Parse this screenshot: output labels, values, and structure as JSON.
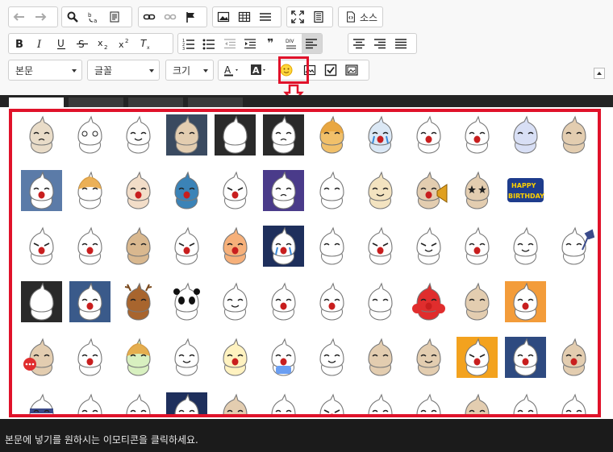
{
  "toolbar": {
    "source_label": "소스",
    "format_combo": "본문",
    "font_combo": "글꼴",
    "size_combo": "크기",
    "quote_label": "❞",
    "div_label": "DIV"
  },
  "emoticons": {
    "items": [
      {
        "skin": "#e9dcc8",
        "bg": "#ffffff",
        "mood": "sad"
      },
      {
        "skin": "#ffffff",
        "bg": "#ffffff",
        "mood": "dizzy"
      },
      {
        "skin": "#ffffff",
        "bg": "#ffffff",
        "mood": "smile"
      },
      {
        "skin": "#e3cdb0",
        "bg": "#3a4a60",
        "mood": "sit"
      },
      {
        "skin": "#ffffff",
        "bg": "#2a2a2a",
        "mood": "back"
      },
      {
        "skin": "#ffffff",
        "bg": "#2a2a2a",
        "mood": "gloom"
      },
      {
        "skin": "#f1c06a",
        "bg": "#ffffff",
        "mood": "hat"
      },
      {
        "skin": "#dbe8f5",
        "bg": "#ffffff",
        "mood": "cry"
      },
      {
        "skin": "#ffffff",
        "bg": "#ffffff",
        "mood": "shout"
      },
      {
        "skin": "#ffffff",
        "bg": "#ffffff",
        "mood": "shout"
      },
      {
        "skin": "#d8dff5",
        "bg": "#ffffff",
        "mood": "shock"
      },
      {
        "skin": "#e3cdb0",
        "bg": "#ffffff",
        "mood": "peek"
      },
      {
        "skin": "#ffffff",
        "bg": "#5b7ba8",
        "mood": "shout"
      },
      {
        "skin": "#ffffff",
        "bg": "#ffffff",
        "mood": "hat"
      },
      {
        "skin": "#f2ddc8",
        "bg": "#ffffff",
        "mood": "shout"
      },
      {
        "skin": "#3b83b7",
        "bg": "#ffffff",
        "mood": "shout"
      },
      {
        "skin": "#ffffff",
        "bg": "#ffffff",
        "mood": "angry"
      },
      {
        "skin": "#ffffff",
        "bg": "#4a3b8a",
        "mood": "gloom"
      },
      {
        "skin": "#ffffff",
        "bg": "#ffffff",
        "mood": "sit"
      },
      {
        "skin": "#f3e3c0",
        "bg": "#ffffff",
        "mood": "smile"
      },
      {
        "skin": "#e3cdb0",
        "bg": "#ffffff",
        "mood": "megaphone"
      },
      {
        "skin": "#e3cdb0",
        "bg": "#ffffff",
        "mood": "star"
      },
      {
        "skin": "#ffffff",
        "bg": "#ffffff",
        "mood": "birthday"
      },
      {
        "skin": "#ffffff",
        "bg": "#ffffff",
        "mood": "none"
      },
      {
        "skin": "#ffffff",
        "bg": "#ffffff",
        "mood": "angry"
      },
      {
        "skin": "#ffffff",
        "bg": "#ffffff",
        "mood": "shout"
      },
      {
        "skin": "#d9b88f",
        "bg": "#ffffff",
        "mood": "bear"
      },
      {
        "skin": "#ffffff",
        "bg": "#ffffff",
        "mood": "angry"
      },
      {
        "skin": "#f6b07a",
        "bg": "#ffffff",
        "mood": "shout"
      },
      {
        "skin": "#ffffff",
        "bg": "#1e2f5c",
        "mood": "cry"
      },
      {
        "skin": "#ffffff",
        "bg": "#ffffff",
        "mood": "sit"
      },
      {
        "skin": "#ffffff",
        "bg": "#ffffff",
        "mood": "angry"
      },
      {
        "skin": "#ffffff",
        "bg": "#ffffff",
        "mood": "smirk"
      },
      {
        "skin": "#ffffff",
        "bg": "#ffffff",
        "mood": "shout"
      },
      {
        "skin": "#ffffff",
        "bg": "#ffffff",
        "mood": "smile"
      },
      {
        "skin": "#ffffff",
        "bg": "#ffffff",
        "mood": "hammer"
      },
      {
        "skin": "#ffffff",
        "bg": "#2a2a2a",
        "mood": "back"
      },
      {
        "skin": "#ffffff",
        "bg": "#3a5a8a",
        "mood": "shout"
      },
      {
        "skin": "#a8652e",
        "bg": "#ffffff",
        "mood": "deer"
      },
      {
        "skin": "#ffffff",
        "bg": "#ffffff",
        "mood": "panda"
      },
      {
        "skin": "#ffffff",
        "bg": "#ffffff",
        "mood": "smile"
      },
      {
        "skin": "#ffffff",
        "bg": "#ffffff",
        "mood": "shout"
      },
      {
        "skin": "#ffffff",
        "bg": "#ffffff",
        "mood": "squeeze"
      },
      {
        "skin": "#ffffff",
        "bg": "#ffffff",
        "mood": "ghost"
      },
      {
        "skin": "#e02d2d",
        "bg": "#ffffff",
        "mood": "boxer"
      },
      {
        "skin": "#e3cdb0",
        "bg": "#ffffff",
        "mood": "sit"
      },
      {
        "skin": "#ffffff",
        "bg": "#f39c3a",
        "mood": "shout"
      },
      {
        "skin": "#ffffff",
        "bg": "#ffffff",
        "mood": "none"
      },
      {
        "skin": "#e3cdb0",
        "bg": "#ffffff",
        "mood": "dots"
      },
      {
        "skin": "#ffffff",
        "bg": "#ffffff",
        "mood": "shout"
      },
      {
        "skin": "#d8f0c0",
        "bg": "#ffffff",
        "mood": "hat"
      },
      {
        "skin": "#ffffff",
        "bg": "#ffffff",
        "mood": "smile"
      },
      {
        "skin": "#fff2c0",
        "bg": "#ffffff",
        "mood": "shout"
      },
      {
        "skin": "#ffffff",
        "bg": "#ffffff",
        "mood": "blue"
      },
      {
        "skin": "#ffffff",
        "bg": "#ffffff",
        "mood": "smile"
      },
      {
        "skin": "#e3cdb0",
        "bg": "#ffffff",
        "mood": "sit"
      },
      {
        "skin": "#e3cdb0",
        "bg": "#ffffff",
        "mood": "smile"
      },
      {
        "skin": "#ffffff",
        "bg": "#f3a21e",
        "mood": "angry"
      },
      {
        "skin": "#ffffff",
        "bg": "#2e4a80",
        "mood": "shout"
      },
      {
        "skin": "#e3cdb0",
        "bg": "#ffffff",
        "mood": "shout"
      },
      {
        "skin": "#ffffff",
        "bg": "#ffffff",
        "mood": "ninja"
      },
      {
        "skin": "#ffffff",
        "bg": "#ffffff",
        "mood": "smile"
      },
      {
        "skin": "#ffffff",
        "bg": "#ffffff",
        "mood": "smile"
      },
      {
        "skin": "#ffffff",
        "bg": "#1e2f5c",
        "mood": "gloom"
      },
      {
        "skin": "#e3cdb0",
        "bg": "#ffffff",
        "mood": "smile"
      },
      {
        "skin": "#ffffff",
        "bg": "#ffffff",
        "mood": "smile"
      },
      {
        "skin": "#ffffff",
        "bg": "#ffffff",
        "mood": "angry"
      },
      {
        "skin": "#ffffff",
        "bg": "#ffffff",
        "mood": "smile"
      },
      {
        "skin": "#ffffff",
        "bg": "#ffffff",
        "mood": "smile"
      },
      {
        "skin": "#e3cdb0",
        "bg": "#ffffff",
        "mood": "smile"
      },
      {
        "skin": "#ffffff",
        "bg": "#ffffff",
        "mood": "smile"
      },
      {
        "skin": "#ffffff",
        "bg": "#ffffff",
        "mood": "smile"
      }
    ]
  },
  "status": {
    "message": "본문에 넣기를 원하시는 이모티콘을 클릭하세요."
  },
  "colors": {
    "highlight": "#e0122a",
    "dark_band": "#242424",
    "status_bar": "#1b1b1b"
  }
}
